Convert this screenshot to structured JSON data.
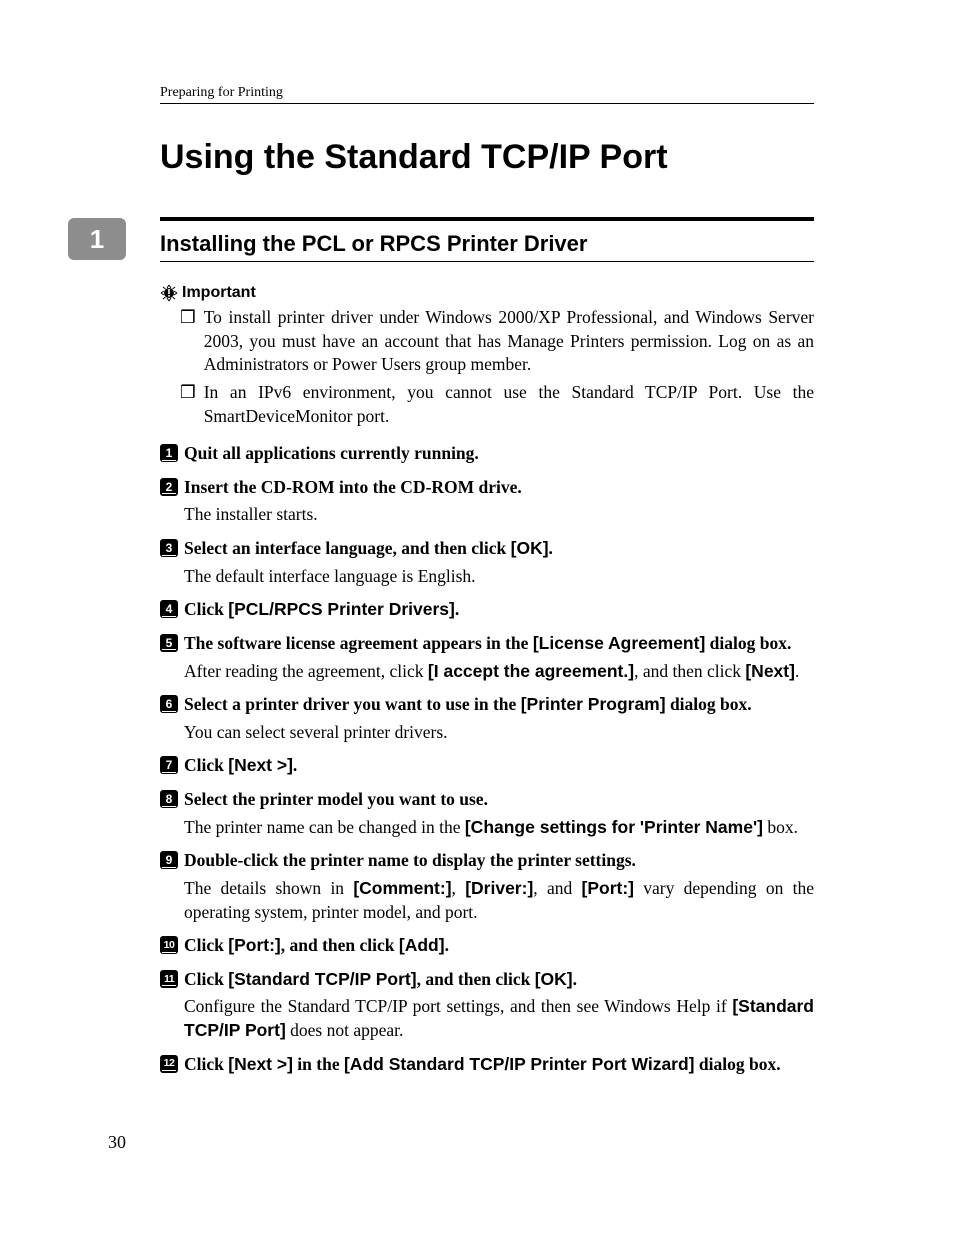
{
  "running_head": "Preparing for Printing",
  "chapter_tab": "1",
  "page_title": "Using the Standard TCP/IP Port",
  "section_title": "Installing the PCL or RPCS Printer Driver",
  "important_label": "Important",
  "bullets": {
    "b1": "To install printer driver under Windows 2000/XP Professional, and Windows Server 2003, you must have an account that has Manage Printers permission. Log on as an Administrators or Power Users group member.",
    "b2": "In an IPv6 environment, you cannot use the Standard TCP/IP Port. Use the SmartDeviceMonitor port."
  },
  "steps": {
    "s1": {
      "title": "Quit all applications currently running."
    },
    "s2": {
      "title": "Insert the CD-ROM into the CD-ROM drive.",
      "body": "The installer starts."
    },
    "s3": {
      "title_pre": "Select an interface language, and then click ",
      "title_btn": "[OK]",
      "title_post": ".",
      "body": "The default interface language is English."
    },
    "s4": {
      "title_pre": "Click ",
      "title_btn": "[PCL/RPCS Printer Drivers]",
      "title_post": "."
    },
    "s5": {
      "title_pre": "The software license agreement appears in the ",
      "title_btn": "[License Agreement]",
      "title_post": " dialog box.",
      "body_pre": "After reading the agreement, click ",
      "body_b1": "[I accept the agreement.]",
      "body_mid": ", and then click ",
      "body_b2": "[Next]",
      "body_post": "."
    },
    "s6": {
      "title_pre": "Select a printer driver you want to use in the ",
      "title_btn": "[Printer Program]",
      "title_post": " dialog box.",
      "body": "You can select several printer drivers."
    },
    "s7": {
      "title_pre": "Click ",
      "title_btn": "[Next >]",
      "title_post": "."
    },
    "s8": {
      "title": "Select the printer model you want to use.",
      "body_pre": "The printer name can be changed in the ",
      "body_b1": "[Change settings for  'Printer Name']",
      "body_post": " box."
    },
    "s9": {
      "title": "Double-click the printer name to display the printer settings.",
      "body_pre": "The details shown in ",
      "body_b1": "[Comment:]",
      "body_mid1": ", ",
      "body_b2": "[Driver:]",
      "body_mid2": ", and ",
      "body_b3": "[Port:]",
      "body_post": " vary depending on the operating system, printer model, and port."
    },
    "s10": {
      "title_pre": "Click ",
      "title_b1": "[Port:]",
      "title_mid": ", and then click ",
      "title_b2": "[Add]",
      "title_post": "."
    },
    "s11": {
      "title_pre": "Click ",
      "title_b1": "[Standard TCP/IP Port]",
      "title_mid": ", and then click ",
      "title_b2": "[OK]",
      "title_post": ".",
      "body_pre": "Configure the Standard TCP/IP port settings, and then see Windows Help if ",
      "body_b1": "[Standard TCP/IP Port]",
      "body_post": " does not appear."
    },
    "s12": {
      "title_pre": "Click ",
      "title_b1": "[Next >]",
      "title_mid": " in the ",
      "title_b2": "[Add Standard TCP/IP Printer Port Wizard]",
      "title_post": " dialog box."
    }
  },
  "page_number": "30",
  "bullet_marker": "❒"
}
